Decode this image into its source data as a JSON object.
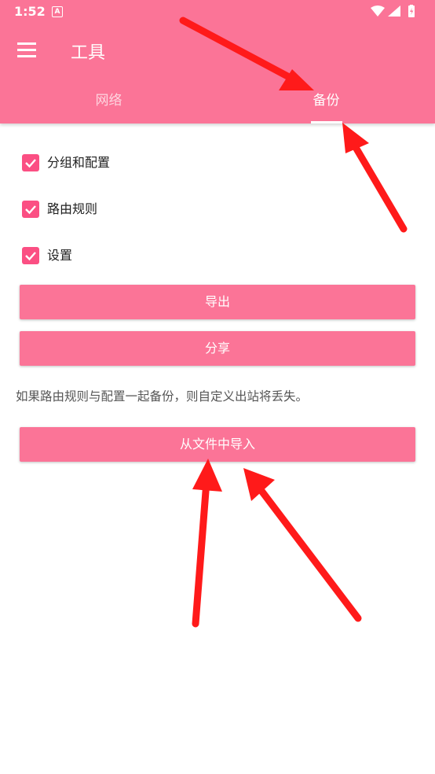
{
  "status_bar": {
    "time": "1:52",
    "notification_icon": "A"
  },
  "toolbar": {
    "title": "工具",
    "menu_icon": "hamburger-menu-icon"
  },
  "tabs": [
    {
      "label": "网络",
      "selected": false
    },
    {
      "label": "备份",
      "selected": true
    }
  ],
  "backup": {
    "options": [
      {
        "label": "分组和配置",
        "checked": true
      },
      {
        "label": "路由规则",
        "checked": true
      },
      {
        "label": "设置",
        "checked": true
      }
    ],
    "export_label": "导出",
    "share_label": "分享",
    "note": "如果路由规则与配置一起备份，则自定义出站将丢失。",
    "import_label": "从文件中导入"
  },
  "colors": {
    "primary": "#fb7497",
    "accent": "#fb4f83",
    "annotation_arrow": "#ff1a1a"
  }
}
